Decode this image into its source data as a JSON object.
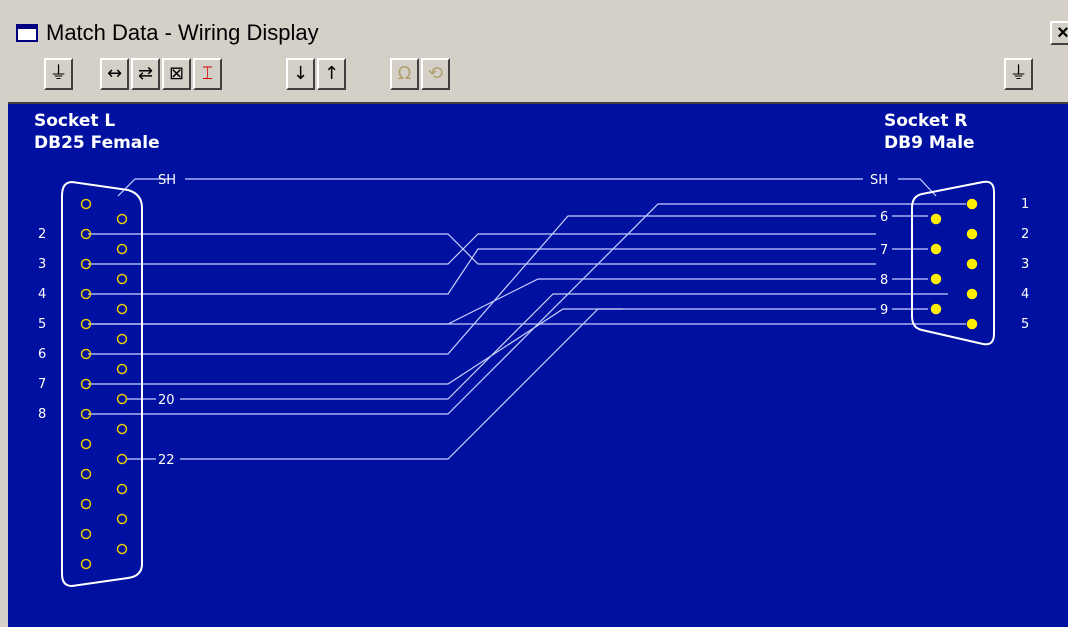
{
  "window": {
    "title": "Match Data - Wiring Display",
    "close_label": "×"
  },
  "toolbar": {
    "buttons": [
      {
        "name": "connector-left-button",
        "icon": "connector-icon",
        "glyph": "⏚"
      },
      {
        "name": "stretch-button",
        "icon": "stretch-horizontal-icon",
        "glyph": "↔"
      },
      {
        "name": "swap-button",
        "icon": "swap-icon",
        "glyph": "⇄"
      },
      {
        "name": "cross-button",
        "icon": "cross-wires-icon",
        "glyph": "⊠"
      },
      {
        "name": "bridge-button",
        "icon": "bridge-icon",
        "glyph": "⌶"
      },
      {
        "name": "move-down-button",
        "icon": "arrow-down-icon",
        "glyph": "↓"
      },
      {
        "name": "move-up-button",
        "icon": "arrow-up-icon",
        "glyph": "↑"
      },
      {
        "name": "resistance-button",
        "icon": "omega-icon",
        "glyph": "Ω"
      },
      {
        "name": "refresh-button",
        "icon": "refresh-icon",
        "glyph": "⟲"
      },
      {
        "name": "connector-right-button",
        "icon": "connector-icon",
        "glyph": "⏚"
      }
    ]
  },
  "left_socket": {
    "name": "Socket L",
    "type": "DB25 Female",
    "pin_labels": [
      "2",
      "3",
      "4",
      "5",
      "6",
      "7",
      "8"
    ],
    "wire_labels": {
      "shield": "SH",
      "pin20": "20",
      "pin22": "22"
    }
  },
  "right_socket": {
    "name": "Socket R",
    "type": "DB9 Male",
    "pin_labels": [
      "1",
      "2",
      "3",
      "4",
      "5"
    ],
    "wire_labels": {
      "shield": "SH",
      "pin6": "6",
      "pin7": "7",
      "pin8": "8",
      "pin9": "9"
    }
  },
  "colors": {
    "canvas": "#0010a0",
    "wire": "#c8d0ff",
    "female_pin": "#e8c800",
    "male_pin": "#ffee00"
  }
}
